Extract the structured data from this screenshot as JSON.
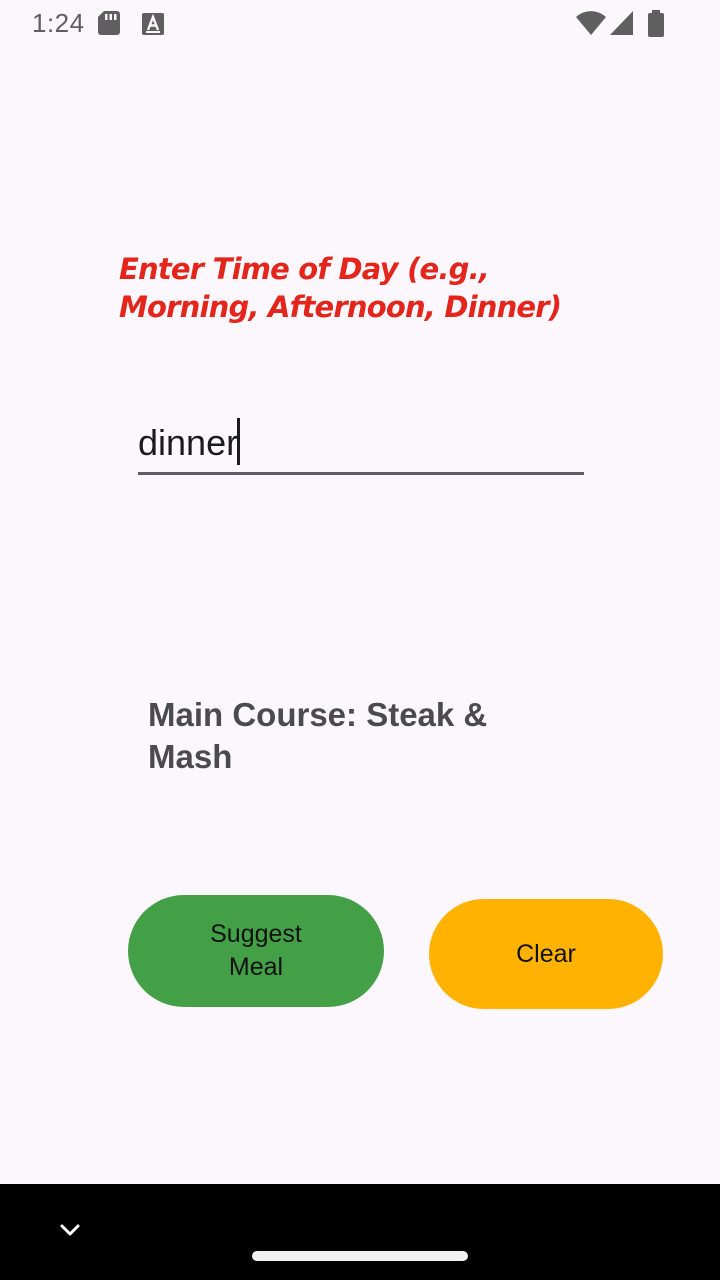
{
  "status_bar": {
    "time": "1:24",
    "icons": [
      "sd-card-icon",
      "text-a-icon",
      "wifi-icon",
      "signal-icon",
      "battery-icon"
    ]
  },
  "prompt": {
    "label": "Enter Time of Day (e.g., Morning, Afternoon, Dinner)",
    "color": "#E3251B"
  },
  "time_input": {
    "value": "dinner",
    "placeholder": ""
  },
  "result": {
    "text": "Main Course: Steak & Mash"
  },
  "buttons": {
    "suggest_label": "Suggest Meal",
    "suggest_color": "#43A047",
    "clear_label": "Clear",
    "clear_color": "#FFB300"
  },
  "nav_bar": {
    "icons": [
      "chevron-down-icon",
      "home-handle"
    ]
  }
}
